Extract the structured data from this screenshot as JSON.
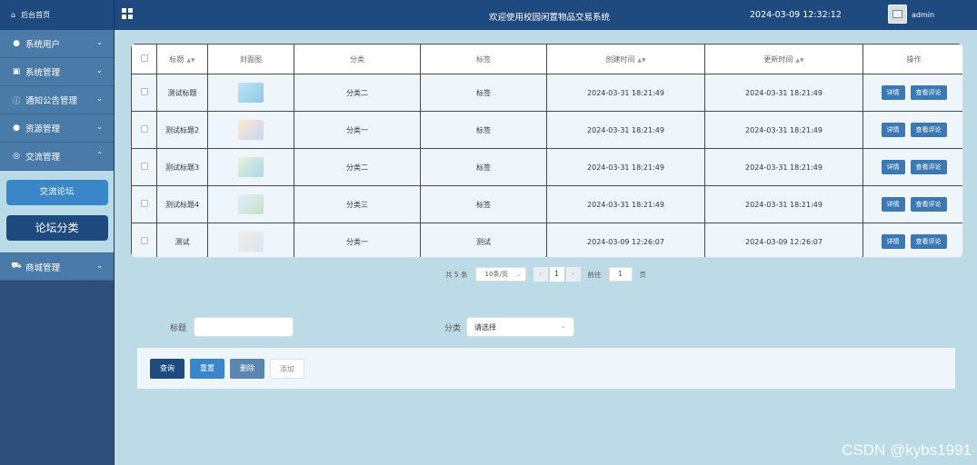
{
  "sidebar": {
    "home": "后台首页",
    "items": [
      {
        "label": "系统用户",
        "icon": "user-icon"
      },
      {
        "label": "系统管理",
        "icon": "image-icon"
      },
      {
        "label": "通知公告管理",
        "icon": "info-icon"
      },
      {
        "label": "资源管理",
        "icon": "location-icon"
      },
      {
        "label": "交流管理",
        "icon": "chat-icon"
      }
    ],
    "submenu": [
      "交流论坛",
      "论坛分类"
    ],
    "shop": {
      "label": "商城管理",
      "icon": "cart-icon"
    }
  },
  "topbar": {
    "title": "欢迎使用校园闲置物品交易系统",
    "datetime": "2024-03-09 12:32:12",
    "user": "admin"
  },
  "table": {
    "headers": [
      "标题",
      "封面图",
      "分类",
      "标签",
      "创建时间",
      "更新时间",
      "操作"
    ],
    "rows": [
      {
        "title": "测试标题",
        "category": "分类二",
        "tag": "标签",
        "created": "2024-03-31 18:21:49",
        "updated": "2024-03-31 18:21:49"
      },
      {
        "title": "测试标题2",
        "category": "分类一",
        "tag": "标签",
        "created": "2024-03-31 18:21:49",
        "updated": "2024-03-31 18:21:49"
      },
      {
        "title": "测试标题3",
        "category": "分类二",
        "tag": "标签",
        "created": "2024-03-31 18:21:49",
        "updated": "2024-03-31 18:21:49"
      },
      {
        "title": "测试标题4",
        "category": "分类三",
        "tag": "标签",
        "created": "2024-03-31 18:21:49",
        "updated": "2024-03-31 18:21:49"
      },
      {
        "title": "测试",
        "category": "分类一",
        "tag": "测试",
        "created": "2024-03-09 12:26:07",
        "updated": "2024-03-09 12:26:07"
      }
    ],
    "detail_label": "详情",
    "comment_label": "查看评论"
  },
  "pager": {
    "total": "共 5 条",
    "page_size": "10条/页",
    "current": "1",
    "goto_prefix": "前往",
    "goto_value": "1",
    "goto_suffix": "页"
  },
  "search": {
    "title_label": "标题",
    "title_value": "",
    "category_label": "分类",
    "category_placeholder": "请选择"
  },
  "actions": {
    "query": "查询",
    "reset": "重置",
    "delete": "删除",
    "add": "添加"
  },
  "watermark": "CSDN @kybs1991"
}
